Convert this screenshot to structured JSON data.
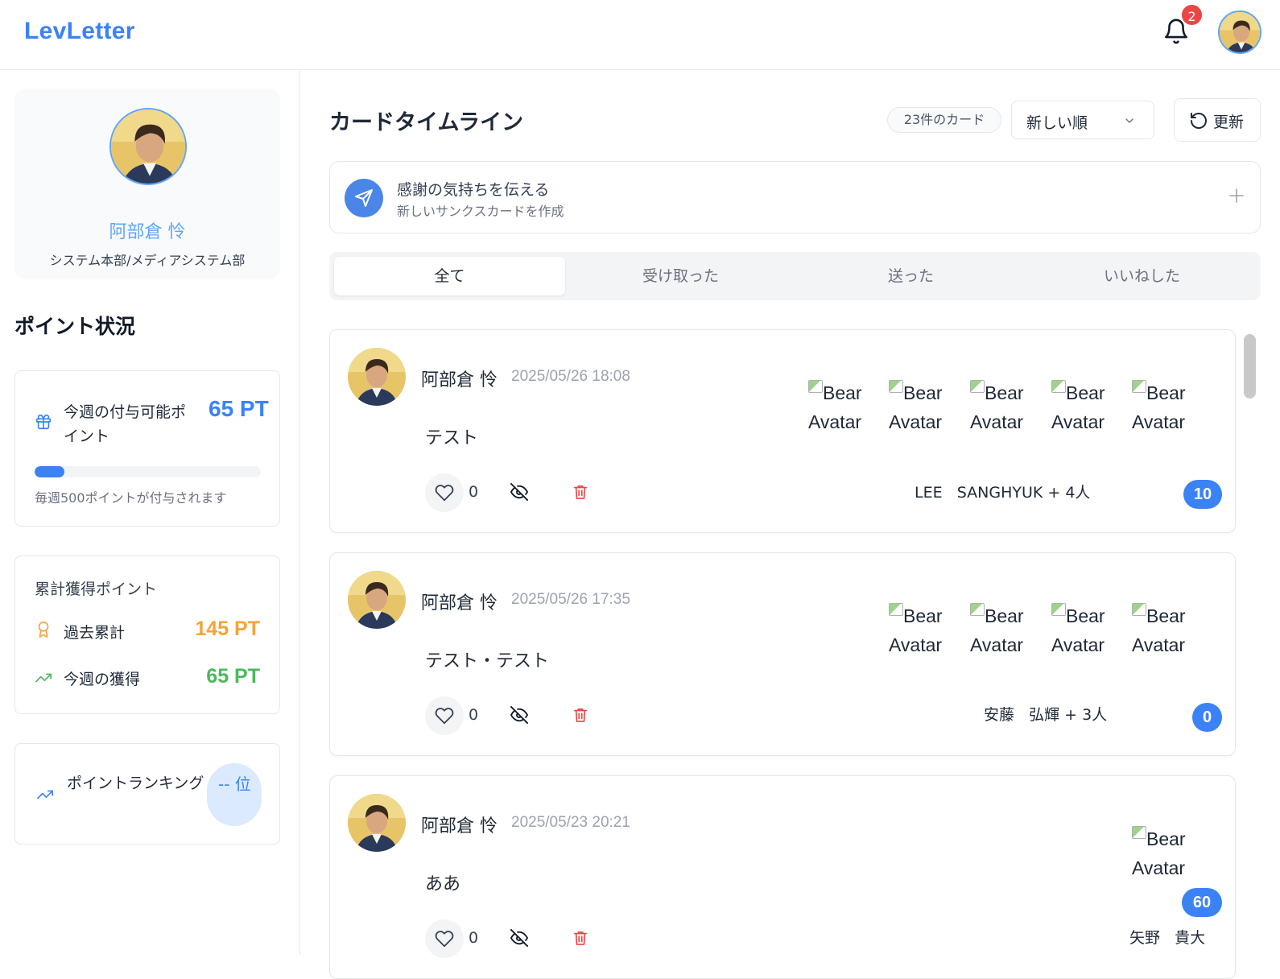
{
  "app": {
    "logo": "LevLetter",
    "notification_count": "2"
  },
  "profile": {
    "name": "阿部倉 怜",
    "department": "システム本部/メディアシステム部"
  },
  "points": {
    "section_title": "ポイント状況",
    "weekly_label": "今週の付与可能ポイント",
    "weekly_value": "65 PT",
    "weekly_progress": 0.13,
    "weekly_note": "毎週500ポイントが付与されます",
    "cumulative_title": "累計獲得ポイント",
    "past_total_label": "過去累計",
    "past_total_value": "145 PT",
    "week_earned_label": "今週の獲得",
    "week_earned_value": "65 PT",
    "ranking_label": "ポイントランキング",
    "ranking_value": "-- 位"
  },
  "main": {
    "title": "カードタイムライン",
    "card_count": "23件のカード",
    "sort_selected": "新しい順",
    "refresh_label": "更新",
    "compose_title": "感謝の気持ちを伝える",
    "compose_subtitle": "新しいサンクスカードを作成",
    "tabs": [
      {
        "label": "全て",
        "active": true
      },
      {
        "label": "受け取った",
        "active": false
      },
      {
        "label": "送った",
        "active": false
      },
      {
        "label": "いいねした",
        "active": false
      }
    ]
  },
  "cards": [
    {
      "author": "阿部倉 怜",
      "date": "2025/05/26 18:08",
      "message": "テスト",
      "likes": "0",
      "recipient_alt": "Bear Avatar",
      "recipient_count": 5,
      "recipient_first": "LEE",
      "recipient_rest": "SANGHYUK + 4人",
      "points": "10"
    },
    {
      "author": "阿部倉 怜",
      "date": "2025/05/26 17:35",
      "message": "テスト・テスト",
      "likes": "0",
      "recipient_alt": "Bear Avatar",
      "recipient_count": 4,
      "recipient_first": "安藤",
      "recipient_rest": "弘輝 + 3人",
      "points": "0"
    },
    {
      "author": "阿部倉 怜",
      "date": "2025/05/23 20:21",
      "message": "ああ",
      "likes": "0",
      "recipient_alt": "Bear Avatar",
      "recipient_count": 1,
      "recipient_first": "矢野",
      "recipient_rest": "貴大",
      "points": "60"
    }
  ],
  "colors": {
    "accent": "#3b82f6",
    "orange": "#f5a33b",
    "green": "#4cb85c",
    "danger": "#ef4444"
  }
}
